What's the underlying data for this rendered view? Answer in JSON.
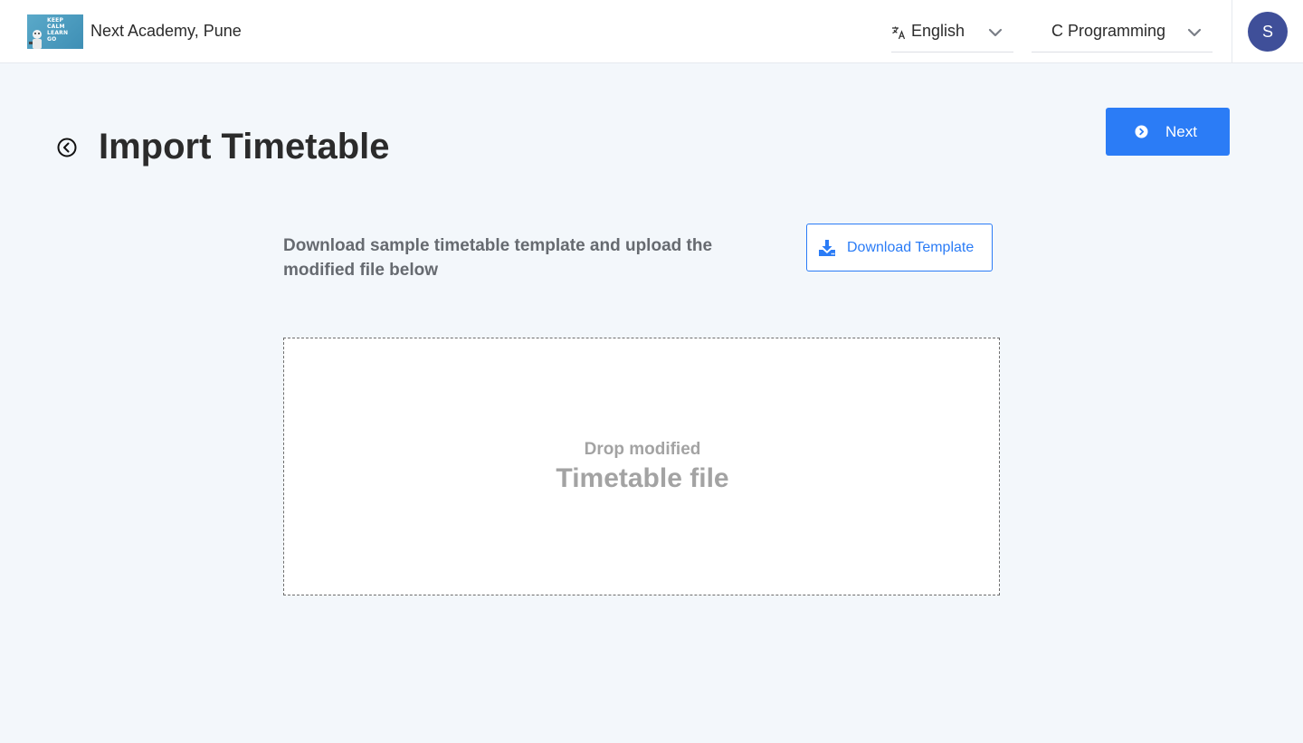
{
  "header": {
    "logo_text": [
      "KEEP",
      "CALM",
      "LEARN",
      "GO"
    ],
    "org_name": "Next Academy, Pune",
    "language": "English",
    "course": "C Programming",
    "avatar_initial": "S"
  },
  "page": {
    "title": "Import Timetable",
    "next_label": "Next",
    "instruction": "Download sample timetable template and upload the modified file below",
    "download_label": "Download Template",
    "drop_line1": "Drop modified",
    "drop_line2": "Timetable file"
  },
  "colors": {
    "accent": "#2b7cf6",
    "avatar": "#3f4f99",
    "background": "#f3f7fb"
  }
}
